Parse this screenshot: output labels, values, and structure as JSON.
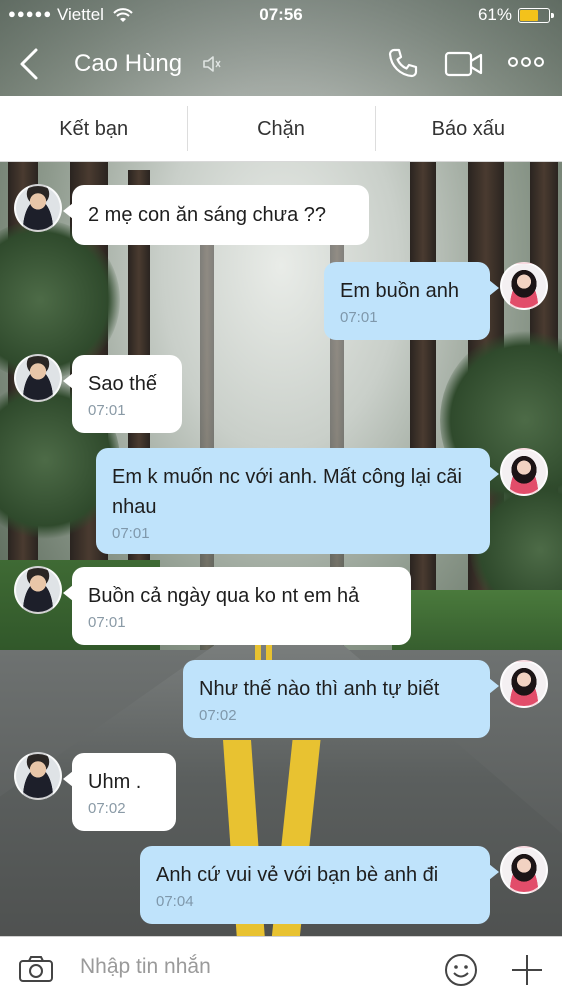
{
  "status_bar": {
    "signal": "●●●●●",
    "carrier": "Viettel",
    "time": "07:56",
    "battery_percent": "61%",
    "battery_level": 0.61,
    "battery_color": "#f3c21b"
  },
  "header": {
    "title": "Cao Hùng",
    "icons": [
      "back-icon",
      "mute-icon",
      "phone-icon",
      "video-call-icon",
      "more-icon"
    ]
  },
  "actions": [
    {
      "label": "Kết bạn"
    },
    {
      "label": "Chặn"
    },
    {
      "label": "Báo xấu"
    }
  ],
  "messages": [
    {
      "side": "in",
      "text": "2 mẹ con ăn sáng chưa ??",
      "time": ""
    },
    {
      "side": "out",
      "text": "Em buồn anh",
      "time": "07:01"
    },
    {
      "side": "in",
      "text": "Sao thế",
      "time": "07:01"
    },
    {
      "side": "out",
      "text": "Em k muốn nc với anh. Mất công lại cãi nhau",
      "time": "07:01"
    },
    {
      "side": "in",
      "text": "Buồn cả ngày qua ko nt em hả",
      "time": "07:01"
    },
    {
      "side": "out",
      "text": "Như thế nào thì anh tự biết",
      "time": "07:02"
    },
    {
      "side": "in",
      "text": "Uhm .",
      "time": "07:02"
    },
    {
      "side": "out",
      "text": "Anh cứ vui vẻ với bạn bè anh đi",
      "time": "07:04"
    }
  ],
  "composer": {
    "placeholder": "Nhập tin nhắn",
    "icons": [
      "camera-icon",
      "emoji-icon",
      "plus-icon"
    ]
  },
  "colors": {
    "incoming_bubble": "#ffffff",
    "outgoing_bubble": "#bfe3fb",
    "time_text": "#8a9aa6"
  }
}
